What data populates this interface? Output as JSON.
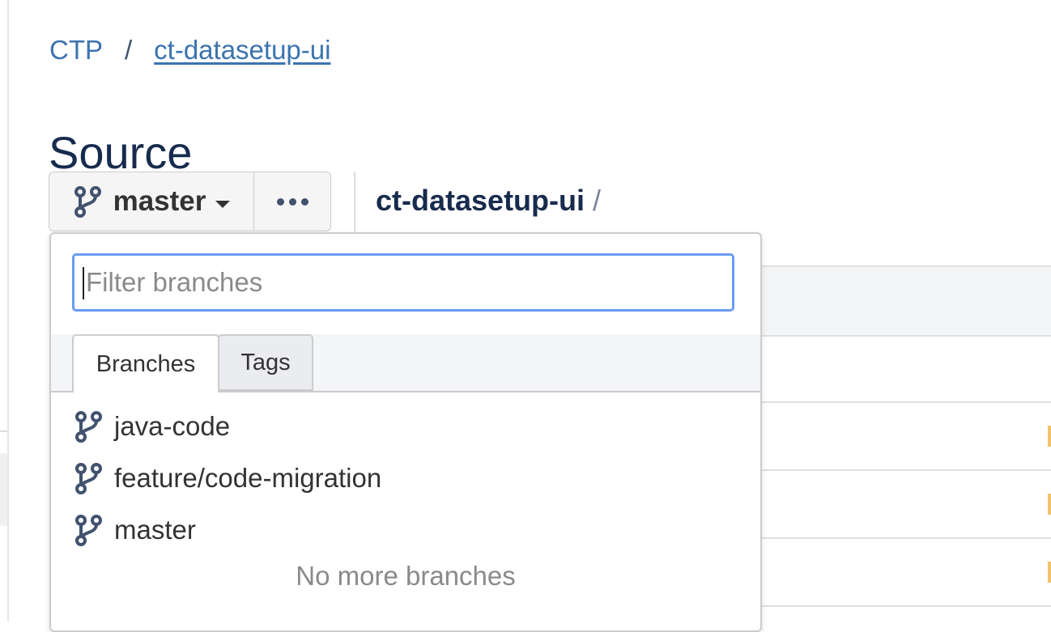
{
  "breadcrumb": {
    "project": "CTP",
    "separator": "/",
    "repo": "ct-datasetup-ui"
  },
  "page": {
    "title": "Source"
  },
  "toolbar": {
    "branch_label": "master",
    "repo_path": "ct-datasetup-ui",
    "path_separator": "/"
  },
  "dropdown": {
    "filter_placeholder": "Filter branches",
    "tabs": [
      {
        "label": "Branches",
        "active": true
      },
      {
        "label": "Tags",
        "active": false
      }
    ],
    "branches": [
      "java-code",
      "feature/code-migration",
      "master"
    ],
    "footer": "No more branches"
  },
  "icons": {
    "branch": "git-branch-icon",
    "caret": "chevron-down-icon",
    "more": "ellipsis-icon"
  },
  "colors": {
    "link": "#3b73af",
    "focus": "#6a9bf4",
    "icon": "#42526e"
  }
}
